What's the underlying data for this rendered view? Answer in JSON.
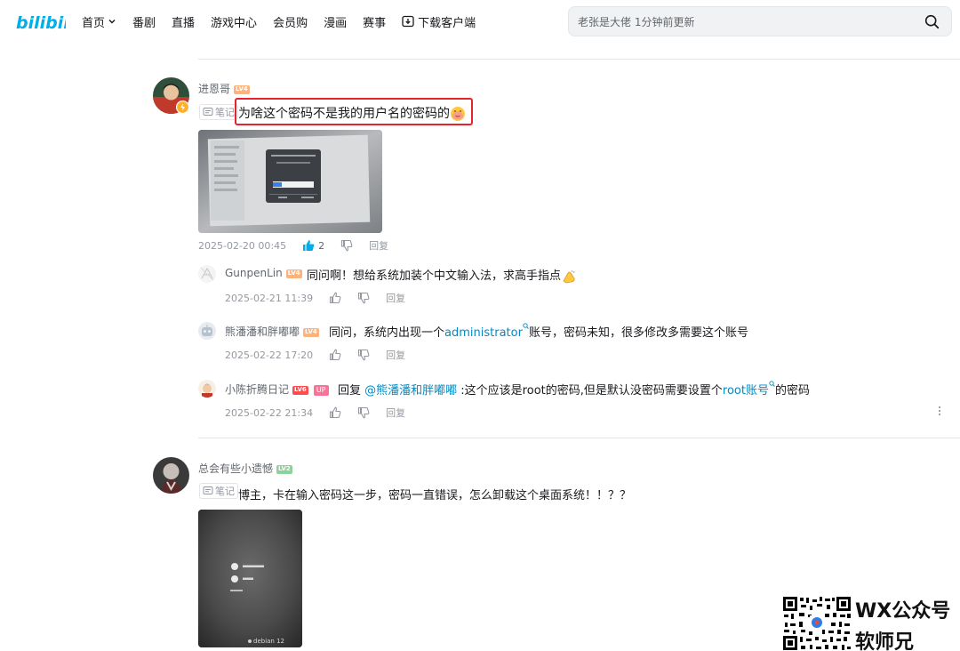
{
  "header": {
    "logo_text": "bilibili",
    "nav": [
      "首页",
      "番剧",
      "直播",
      "游戏中心",
      "会员购",
      "漫画",
      "赛事",
      "下载客户端"
    ],
    "search_placeholder": "老张是大佬 1分钟前更新"
  },
  "comments": [
    {
      "user": "进恩哥",
      "level": "LV4",
      "note_label": "笔记",
      "text": "为啥这个密码不是我的用户名的密码的",
      "date": "2025-02-20 00:45",
      "likes": "2",
      "reply_label": "回复",
      "replies": [
        {
          "user": "GunpenLin",
          "level": "LV4",
          "text": "同问啊！想给系统加装个中文输入法，求高手指点",
          "date": "2025-02-21 11:39",
          "reply_label": "回复"
        },
        {
          "user": "熊潘潘和胖嘟嘟",
          "level": "LV4",
          "text_before": "同问，系统内出现一个",
          "link": "administrator",
          "text_after": "账号，密码未知，很多修改多需要这个账号",
          "date": "2025-02-22 17:20",
          "reply_label": "回复"
        },
        {
          "user": "小陈折腾日记",
          "level": "LV6",
          "up_badge": "UP",
          "reply_word": "回复",
          "mention": "@熊潘潘和胖嘟嘟",
          "text_before": " :这个应该是root的密码,但是默认没密码需要设置个",
          "link": "root账号",
          "text_after": "的密码",
          "date": "2025-02-22 21:34",
          "reply_label": "回复"
        }
      ]
    },
    {
      "user": "总会有些小遗憾",
      "level": "LV2",
      "note_label": "笔记",
      "text": "博主，卡在输入密码这一步，密码一直错误，怎么卸载这个桌面系统！！？？",
      "screen_text": [
        "debian 12"
      ]
    }
  ],
  "watermark": {
    "line1": "WX公众号",
    "line2": "软师兄"
  },
  "colors": {
    "brand": "#00aeec",
    "link": "#008ac5",
    "highlight": "#e8232e"
  }
}
